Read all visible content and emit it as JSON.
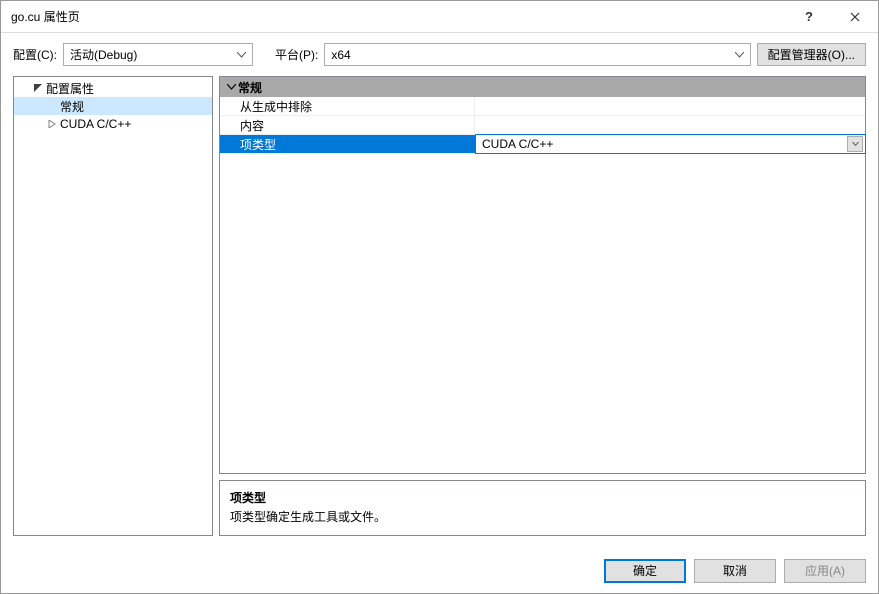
{
  "titlebar": {
    "title": "go.cu 属性页",
    "help": "?",
    "close": "×"
  },
  "config": {
    "config_label": "配置(C):",
    "config_value": "活动(Debug)",
    "platform_label": "平台(P):",
    "platform_value": "x64",
    "manager_btn": "配置管理器(O)..."
  },
  "tree": {
    "root": "配置属性",
    "items": [
      "常规",
      "CUDA C/C++"
    ]
  },
  "propgrid": {
    "section": "常规",
    "rows": [
      {
        "name": "从生成中排除",
        "value": ""
      },
      {
        "name": "内容",
        "value": ""
      },
      {
        "name": "项类型",
        "value": "CUDA C/C++"
      }
    ]
  },
  "description": {
    "title": "项类型",
    "text": "项类型确定生成工具或文件。"
  },
  "footer": {
    "ok": "确定",
    "cancel": "取消",
    "apply": "应用(A)"
  }
}
